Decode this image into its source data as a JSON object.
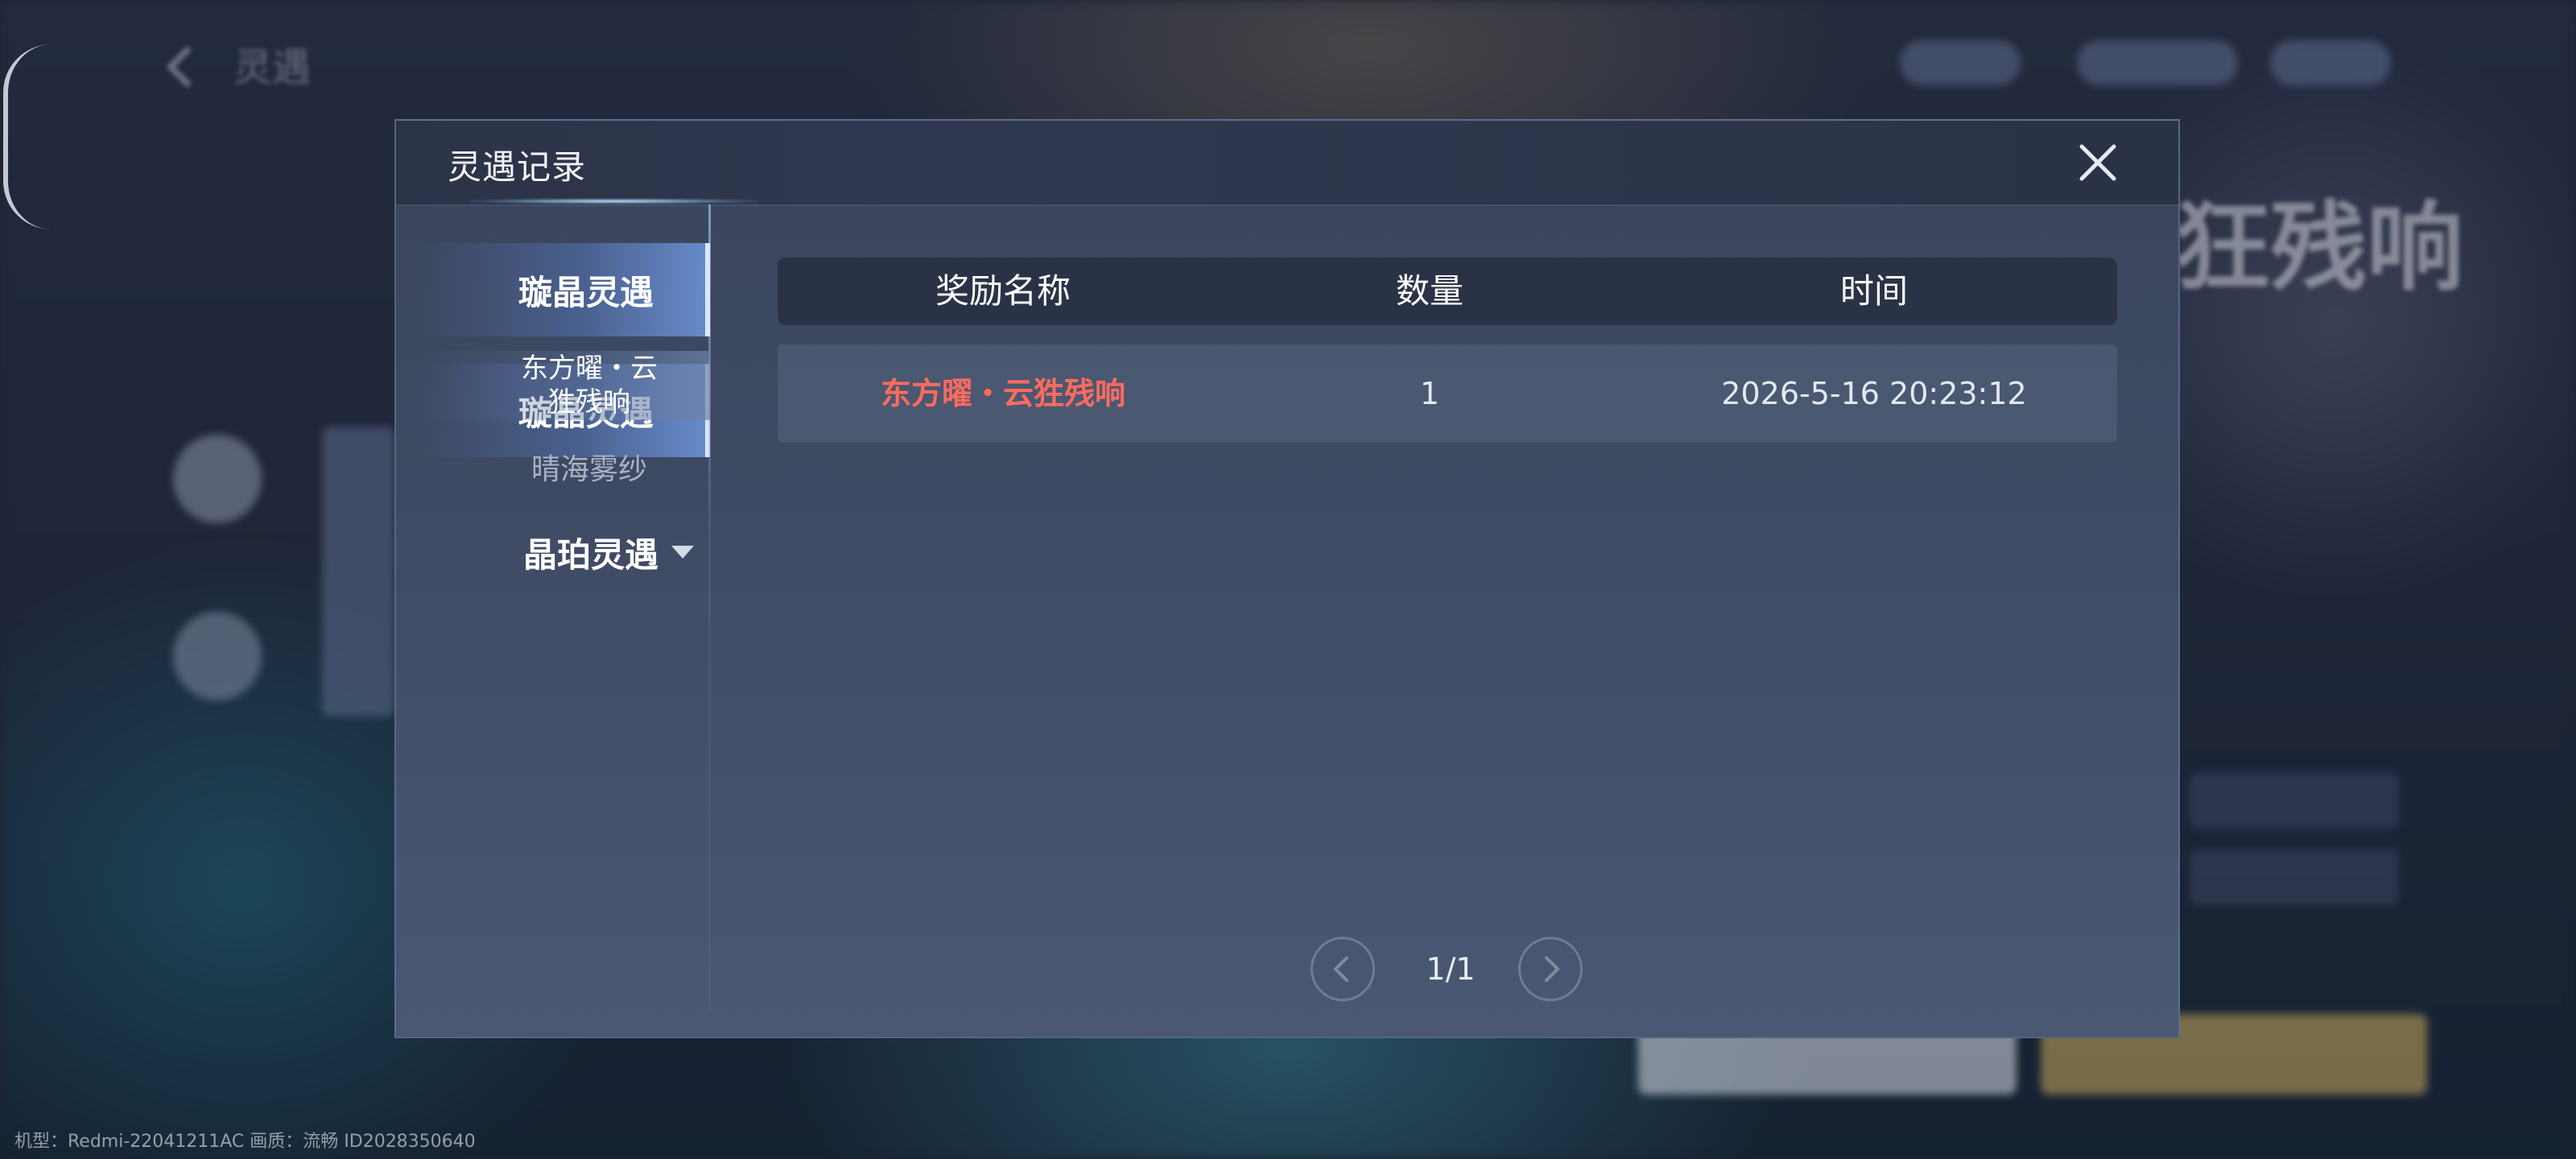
{
  "background": {
    "back_label": "灵遇",
    "right_banner_text": "狂残响"
  },
  "footer": {
    "device_info": "机型：Redmi-22041211AC 画质：流畅 ID2028350640"
  },
  "dialog": {
    "title": "灵遇记录",
    "close_icon": "close-icon",
    "sidebar": {
      "categories": [
        {
          "label": "璇晶灵遇",
          "active": true,
          "subitems": [
            {
              "label": "东方曜・云狌残响",
              "active": true
            },
            {
              "label": "晴海雾纱",
              "active": false
            }
          ]
        },
        {
          "label": "晶珀灵遇",
          "active": false,
          "icon": "chevron-down-icon"
        }
      ]
    },
    "table": {
      "columns": [
        "奖励名称",
        "数量",
        "时间"
      ],
      "rows": [
        {
          "name": "东方曜・云狌残响",
          "quantity": "1",
          "time": "2026-5-16 20:23:12"
        }
      ]
    },
    "pagination": {
      "indicator": "1/1",
      "prev_icon": "chevron-left-icon",
      "next_icon": "chevron-right-icon"
    }
  },
  "colors": {
    "reward_highlight": "#ff6b5e",
    "dialog_bg": "#3e4a63",
    "header_bg": "#2b3347"
  }
}
